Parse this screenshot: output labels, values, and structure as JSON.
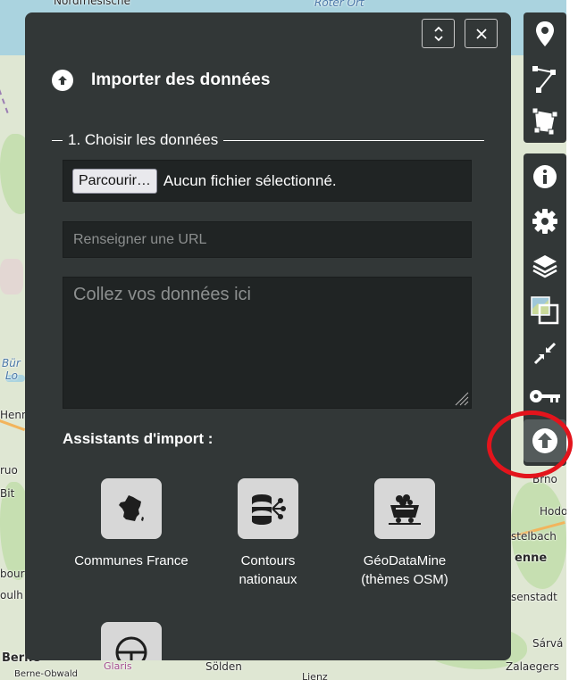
{
  "panel": {
    "title": "Importer des données",
    "legend": "1. Choisir les données",
    "file_button_label": "Parcourir…",
    "file_status": "Aucun fichier sélectionné.",
    "url_placeholder": "Renseigner une URL",
    "paste_placeholder": "Collez vos données ici",
    "assistants_title": "Assistants d'import :",
    "assistants": [
      {
        "label_line1": "Communes France",
        "label_line2": "",
        "icon": "france-map-icon"
      },
      {
        "label_line1": "Contours",
        "label_line2": "nationaux",
        "icon": "database-icon"
      },
      {
        "label_line1": "GéoDataMine",
        "label_line2": "(thèmes OSM)",
        "icon": "mine-cart-icon"
      },
      {
        "label_line1": "",
        "label_line2": "",
        "icon": "steering-wheel-icon"
      }
    ]
  },
  "toolbar": {
    "group1": [
      "marker-icon",
      "polyline-icon",
      "polygon-icon"
    ],
    "group2": [
      "info-icon",
      "gear-icon",
      "layers-icon",
      "tilelayer-icon",
      "center-map-icon",
      "key-icon",
      "import-icon"
    ],
    "active": "import-icon"
  },
  "map_labels": {
    "nord": "Nordfriesische",
    "roter": "Roter Ort",
    "burg": "Bür",
    "lo": "Lo",
    "henn": "Henn",
    "bern": "Berne",
    "glaris": "Glaris",
    "solden": "Sölden",
    "zalaeg": "Zalaegers",
    "hodo": "Hodo",
    "stelbach": "stelbach",
    "enne": "enne",
    "senstadt": "senstadt",
    "sarv": "Sárvá",
    "brno": "Brno",
    "bitt": "Bit",
    "eruo": "ruo",
    "bourg": "bourg",
    "ouhl": "oulh",
    "bern_oberland": "Berne-Obwald",
    "lienz": "Lienz"
  },
  "colors": {
    "panel_bg": "#323737",
    "input_bg": "#202424",
    "tile_bg": "#d7d7d7",
    "highlight": "#e3141c"
  }
}
